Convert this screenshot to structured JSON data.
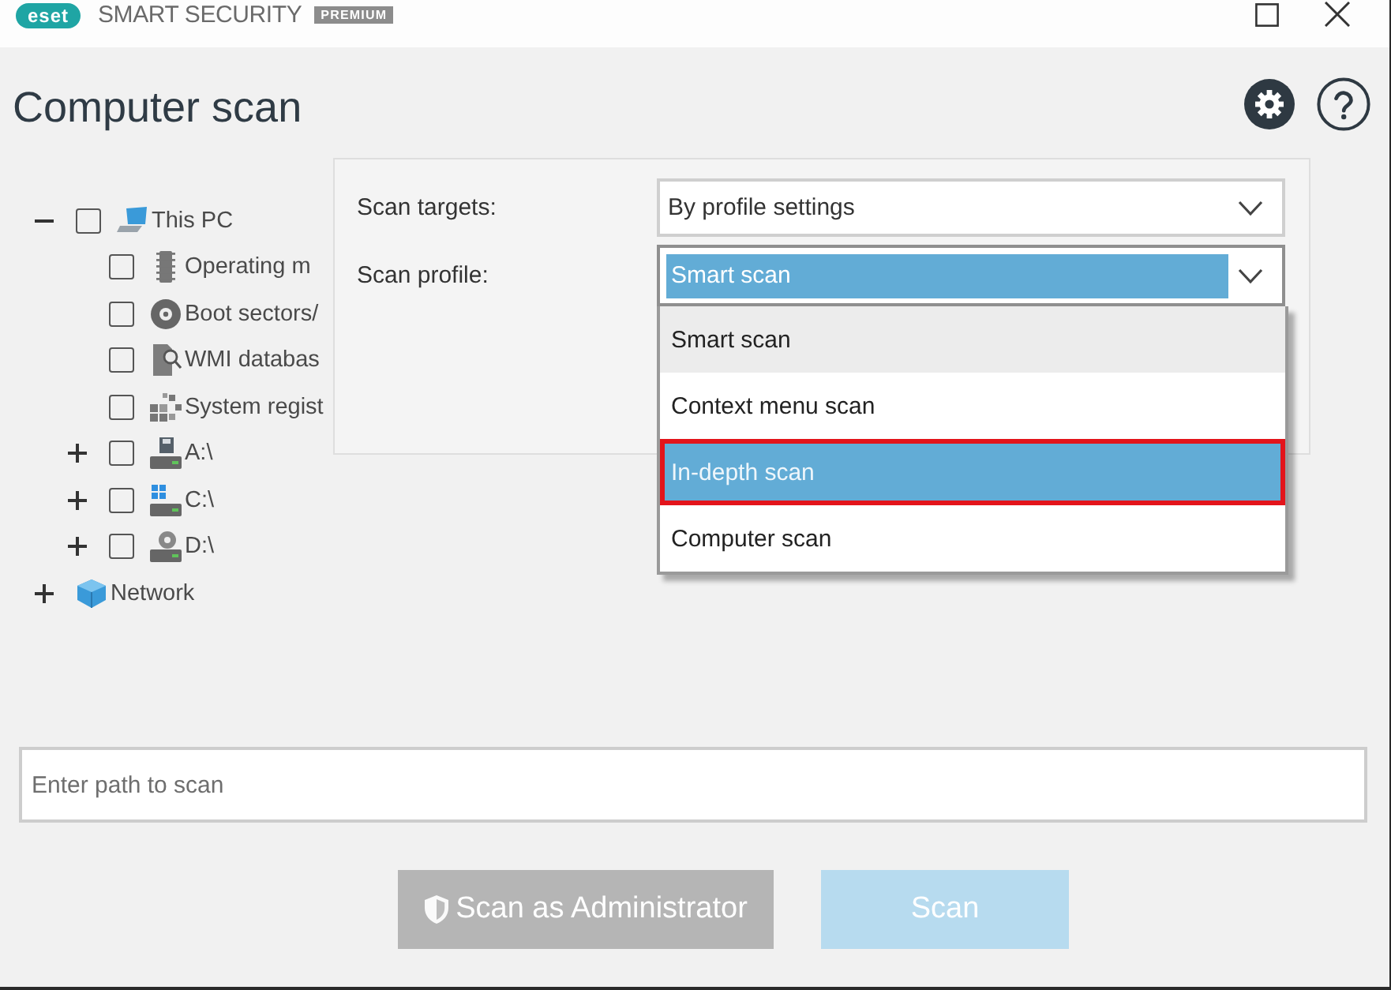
{
  "title_bar": {
    "logo": "eset",
    "product": "SMART SECURITY",
    "edition": "PREMIUM"
  },
  "header": {
    "title": "Computer scan"
  },
  "tree": [
    {
      "label": "This PC",
      "kind": "computer",
      "expanded": true,
      "checked": false,
      "children": [
        {
          "label": "Operating m",
          "kind": "memory",
          "checked": false
        },
        {
          "label": "Boot sectors/",
          "kind": "disc",
          "checked": false
        },
        {
          "label": "WMI databas",
          "kind": "document-search",
          "checked": false
        },
        {
          "label": "System regist",
          "kind": "blocks",
          "checked": false
        },
        {
          "label": "A:\\",
          "kind": "floppy-drive",
          "expanded": false,
          "checked": false
        },
        {
          "label": "C:\\",
          "kind": "system-drive",
          "expanded": false,
          "checked": false
        },
        {
          "label": "D:\\",
          "kind": "optical-drive",
          "expanded": false,
          "checked": false
        }
      ]
    },
    {
      "label": "Network",
      "kind": "network",
      "expanded": false
    }
  ],
  "scan_settings": {
    "targets": {
      "label": "Scan targets:",
      "value": "By profile settings"
    },
    "profile": {
      "label": "Scan profile:",
      "value": "Smart scan",
      "focused": true,
      "expanded": true,
      "options": [
        {
          "label": "Smart scan",
          "selected": true,
          "hovered": false,
          "annotated": false
        },
        {
          "label": "Context menu scan",
          "selected": false,
          "hovered": false,
          "annotated": false
        },
        {
          "label": "In-depth scan",
          "selected": false,
          "hovered": true,
          "annotated": true
        },
        {
          "label": "Computer scan",
          "selected": false,
          "hovered": false,
          "annotated": false
        }
      ]
    }
  },
  "path_field": {
    "placeholder": "Enter path to scan"
  },
  "buttons": [
    {
      "label": "Scan as Administrator",
      "kind": "admin",
      "disabled": true
    },
    {
      "label": "Scan",
      "kind": "primary",
      "disabled": true
    }
  ]
}
